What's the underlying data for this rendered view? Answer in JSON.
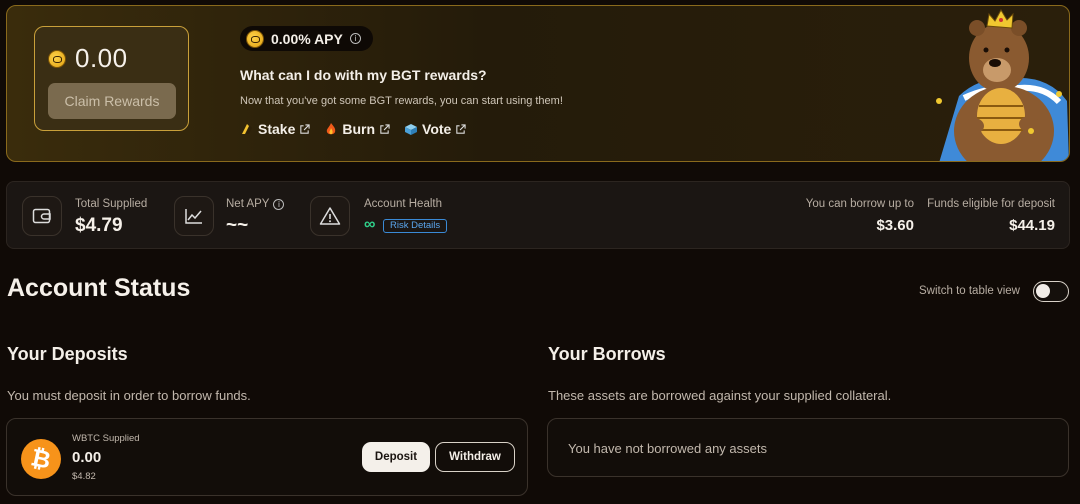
{
  "rewards": {
    "amount": "0.00",
    "claim_label": "Claim Rewards",
    "apy_label": "0.00% APY",
    "title": "What can I do with my BGT rewards?",
    "subtitle": "Now that you've got some BGT rewards, you can start using them!",
    "actions": [
      {
        "label": "Stake",
        "icon": "honey-stake-icon"
      },
      {
        "label": "Burn",
        "icon": "fire-icon"
      },
      {
        "label": "Vote",
        "icon": "ballot-box-icon"
      }
    ]
  },
  "stats": {
    "total_supplied_label": "Total Supplied",
    "total_supplied_value": "$4.79",
    "net_apy_label": "Net APY",
    "net_apy_value": "~~",
    "account_health_label": "Account Health",
    "account_health_value": "∞",
    "risk_details_label": "Risk Details",
    "borrow_up_to_label": "You can borrow up to",
    "borrow_up_to_value": "$3.60",
    "eligible_label": "Funds eligible for deposit",
    "eligible_value": "$44.19"
  },
  "account": {
    "title": "Account Status",
    "toggle_label": "Switch to table view",
    "toggle_on": false
  },
  "deposits": {
    "title": "Your Deposits",
    "subtitle": "You must deposit in order to borrow funds.",
    "items": [
      {
        "asset_label": "WBTC Supplied",
        "amount": "0.00",
        "usd": "$4.82",
        "icon": "bitcoin-icon"
      }
    ],
    "deposit_label": "Deposit",
    "withdraw_label": "Withdraw"
  },
  "borrows": {
    "title": "Your Borrows",
    "subtitle": "These assets are borrowed against your supplied collateral.",
    "empty_message": "You have not borrowed any assets"
  },
  "colors": {
    "accent_gold": "#c9a03a",
    "health_green": "#2fcf8a",
    "risk_blue": "#3a8ad6",
    "bitcoin_orange": "#f7931a"
  }
}
